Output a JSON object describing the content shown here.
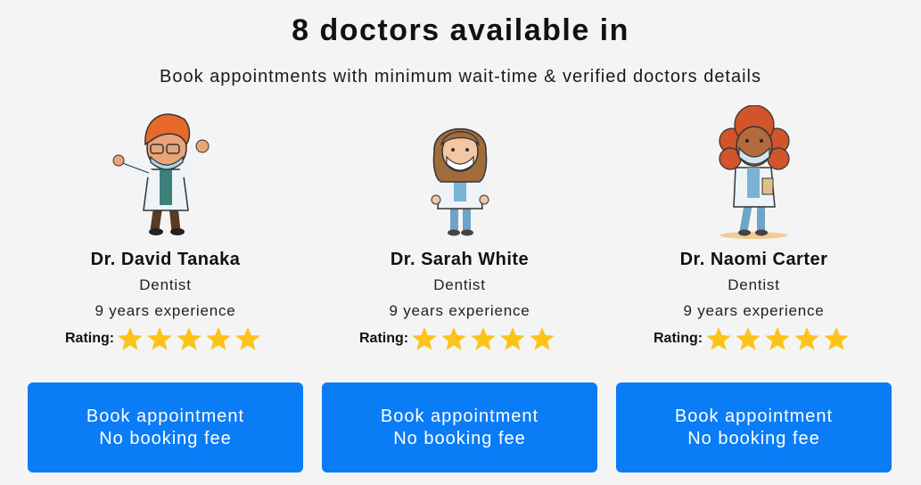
{
  "header": {
    "title": "8 doctors available in",
    "subtitle": "Book appointments with minimum wait-time & verified doctors details"
  },
  "doctors": [
    {
      "name": "Dr. David Tanaka",
      "specialty": "Dentist",
      "experience": "9 years experience",
      "rating_label": "Rating:",
      "rating_stars": 5,
      "avatar_icon": "doctor-male-avatar",
      "button_line1": "Book appointment",
      "button_line2": "No booking fee"
    },
    {
      "name": "Dr. Sarah White",
      "specialty": "Dentist",
      "experience": "9 years experience",
      "rating_label": "Rating:",
      "rating_stars": 5,
      "avatar_icon": "doctor-female-avatar",
      "button_line1": "Book appointment",
      "button_line2": "No booking fee"
    },
    {
      "name": "Dr. Naomi Carter",
      "specialty": "Dentist",
      "experience": "9 years experience",
      "rating_label": "Rating:",
      "rating_stars": 5,
      "avatar_icon": "doctor-female-curly-avatar",
      "button_line1": "Book appointment",
      "button_line2": "No booking fee"
    }
  ],
  "colors": {
    "background": "#f4f4f4",
    "button": "#0a7cf6",
    "star": "#fcc419"
  }
}
